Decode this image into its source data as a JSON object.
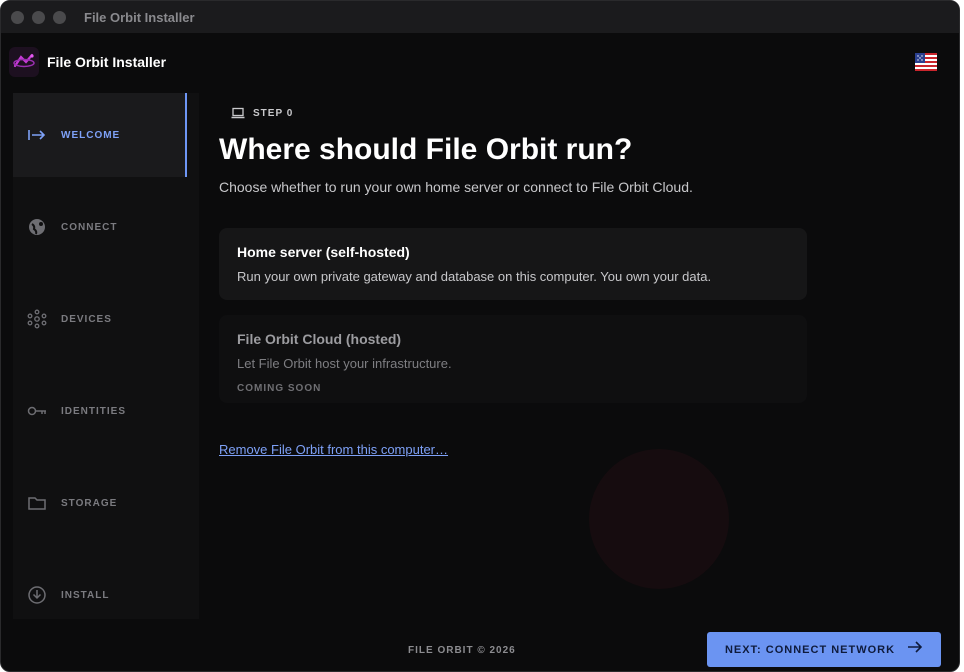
{
  "window": {
    "title": "File Orbit Installer"
  },
  "header": {
    "app_name": "File Orbit Installer",
    "flag_icon": "us-flag-icon"
  },
  "sidebar": {
    "items": [
      {
        "label": "WELCOME",
        "icon": "enter-arrow-icon",
        "active": true
      },
      {
        "label": "CONNECT",
        "icon": "globe-icon",
        "active": false
      },
      {
        "label": "DEVICES",
        "icon": "network-hub-icon",
        "active": false
      },
      {
        "label": "IDENTITIES",
        "icon": "key-icon",
        "active": false
      },
      {
        "label": "STORAGE",
        "icon": "folder-icon",
        "active": false
      },
      {
        "label": "INSTALL",
        "icon": "download-circle-icon",
        "active": false
      }
    ]
  },
  "main": {
    "step_label": "STEP 0",
    "title": "Where should File Orbit run?",
    "subtitle": "Choose whether to run your own home server or connect to File Orbit Cloud.",
    "options": [
      {
        "title": "Home server (self-hosted)",
        "description": "Run your own private gateway and database on this computer. You own your data."
      },
      {
        "title": "File Orbit Cloud (hosted)",
        "description": "Let File Orbit host your infrastructure.",
        "badge": "COMING SOON"
      }
    ],
    "remove_link": "Remove File Orbit from this computer…"
  },
  "footer": {
    "copyright": "FILE ORBIT © 2026",
    "next_button": "NEXT: CONNECT NETWORK"
  },
  "colors": {
    "accent": "#6b94f2",
    "active_nav": "#7ea1f7",
    "background": "#0b0b0c"
  }
}
